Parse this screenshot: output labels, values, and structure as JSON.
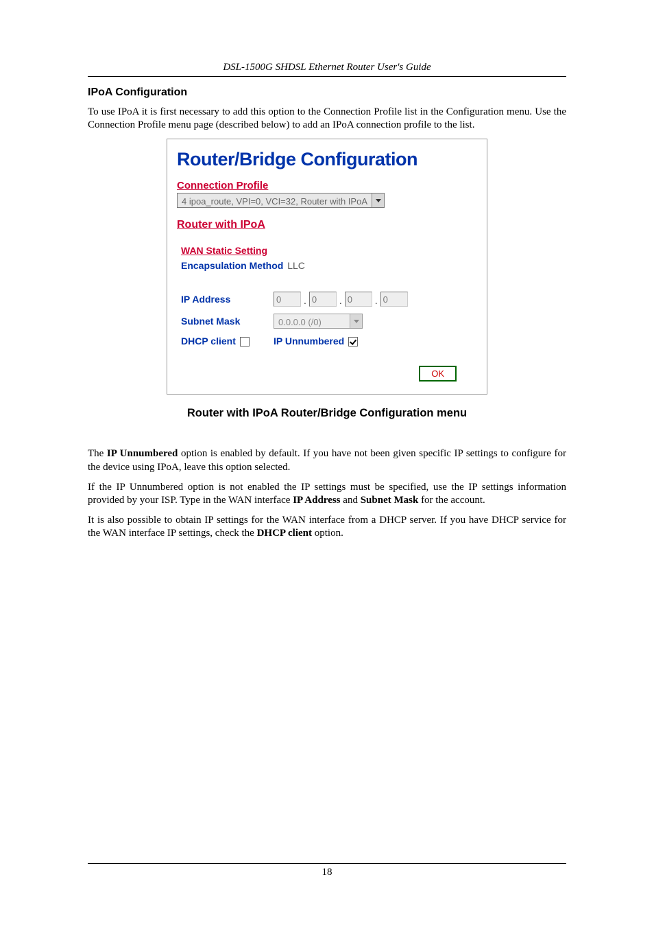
{
  "doc_header": "DSL-1500G SHDSL Ethernet Router User's Guide",
  "section_heading": "IPoA Configuration",
  "intro_text": "To use IPoA it is first necessary to add this option to the Connection Profile list in the Configuration menu. Use the Connection Profile menu page (described below) to add an IPoA connection profile to the list.",
  "panel": {
    "title": "Router/Bridge Configuration",
    "connection_profile_label": "Connection Profile",
    "connection_profile_value": "4 ipoa_route, VPI=0, VCI=32, Router with IPoA",
    "router_section": "Router with IPoA",
    "wan_heading": "WAN Static Setting",
    "encapsulation_label": "Encapsulation Method",
    "encapsulation_value": "LLC",
    "ip_label": "IP Address",
    "ip_octets": [
      "0",
      "0",
      "0",
      "0"
    ],
    "subnet_label": "Subnet Mask",
    "subnet_value": "0.0.0.0 (/0)",
    "dhcp_label": "DHCP client",
    "dhcp_checked": false,
    "ipun_label": "IP Unnumbered",
    "ipun_checked": true,
    "ok_label": "OK"
  },
  "figure_caption": "Router with IPoA Router/Bridge Configuration menu",
  "para1_a": "The ",
  "para1_b": "IP Unnumbered",
  "para1_c": " option is enabled by default. If you have not been given specific IP settings to configure for the device using IPoA, leave this option selected.",
  "para2_a": "If the IP Unnumbered option is not enabled the IP settings must be specified, use the IP settings information provided by your ISP. Type in the WAN interface ",
  "para2_b": "IP Address",
  "para2_c": " and ",
  "para2_d": "Subnet Mask",
  "para2_e": " for the account.",
  "para3_a": "It is also possible to obtain IP settings for the WAN interface from a DHCP server. If you have DHCP service for the WAN interface IP settings, check the ",
  "para3_b": "DHCP client",
  "para3_c": " option.",
  "page_number": "18"
}
